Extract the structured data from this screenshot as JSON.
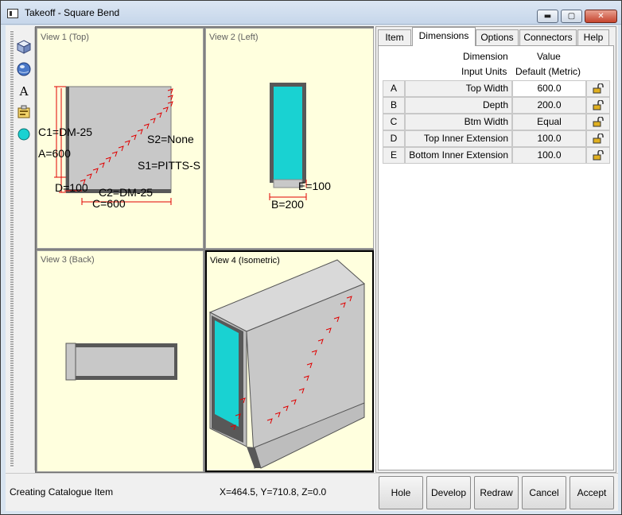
{
  "window": {
    "title": "Takeoff - Square Bend"
  },
  "window_controls": {
    "minimize": "▬",
    "maximize": "▢",
    "close": "✕"
  },
  "toolbar": {
    "icons": [
      "cube-icon",
      "globe-icon",
      "text-icon",
      "properties-icon",
      "cyan-ellipse-icon"
    ],
    "text_glyph": "A"
  },
  "views": {
    "view1": {
      "label": "View 1 (Top)",
      "annotations": {
        "c1": "C1=DM-25",
        "a": "A=600",
        "s2": "S2=None",
        "s1": "S1=PITTS-S",
        "d": "D=100",
        "c2": "C2=DM-25",
        "c": "C=600"
      }
    },
    "view2": {
      "label": "View 2 (Left)",
      "annotations": {
        "e": "E=100",
        "b": "B=200"
      }
    },
    "view3": {
      "label": "View 3 (Back)"
    },
    "view4": {
      "label": "View 4 (Isometric)"
    }
  },
  "colors": {
    "viewport_bg": "#ffffde",
    "duct_fill": "#c8c8c8",
    "duct_edge": "#585858",
    "opening": "#19d2d2",
    "dimension_red": "#e00000"
  },
  "panel": {
    "tabs": [
      {
        "label": "Item",
        "active": false
      },
      {
        "label": "Dimensions",
        "active": true
      },
      {
        "label": "Options",
        "active": false
      },
      {
        "label": "Connectors",
        "active": false
      },
      {
        "label": "Help",
        "active": false
      }
    ],
    "header": {
      "dimension": "Dimension",
      "value": "Value",
      "input_units_label": "Input Units",
      "input_units_value": "Default (Metric)"
    },
    "rows": [
      {
        "key": "A",
        "name": "Top Width",
        "value": "600.0"
      },
      {
        "key": "B",
        "name": "Depth",
        "value": "200.0"
      },
      {
        "key": "C",
        "name": "Btm Width",
        "value": "Equal"
      },
      {
        "key": "D",
        "name": "Top Inner Extension",
        "value": "100.0"
      },
      {
        "key": "E",
        "name": "Bottom Inner Extension",
        "value": "100.0"
      }
    ]
  },
  "status": {
    "message": "Creating Catalogue Item",
    "coords": "X=464.5, Y=710.8, Z=0.0"
  },
  "buttons": {
    "hole": "Hole",
    "develop": "Develop",
    "redraw": "Redraw",
    "cancel": "Cancel",
    "accept": "Accept"
  }
}
